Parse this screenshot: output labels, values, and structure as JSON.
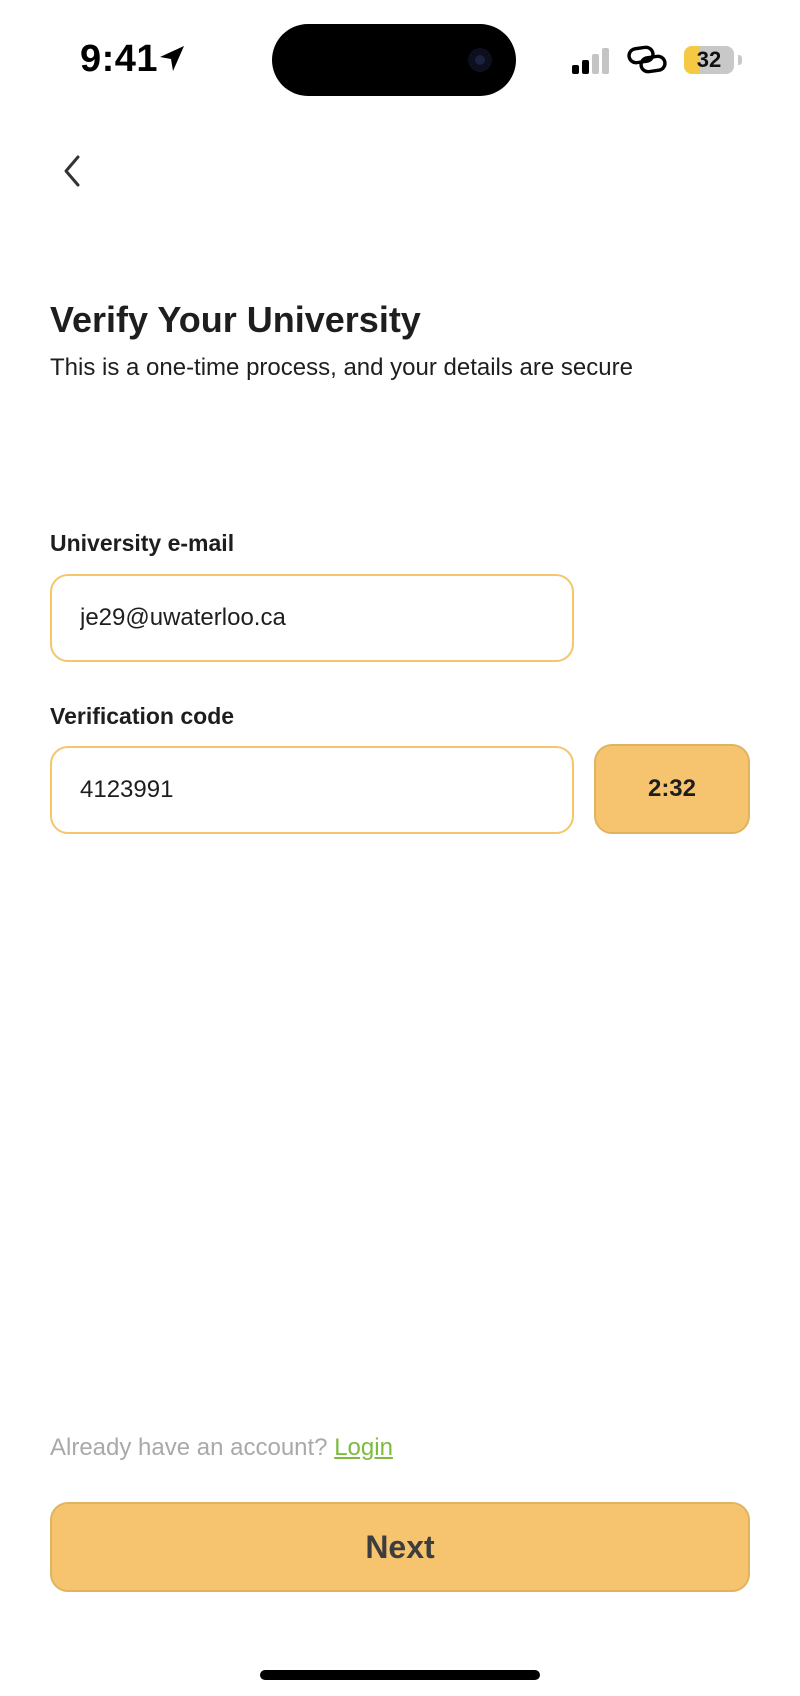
{
  "status_bar": {
    "time": "9:41",
    "battery_level": 32,
    "battery_label": "32",
    "battery_color": "#f6c945"
  },
  "header": {
    "back_icon": "chevron-left-icon",
    "title": "Verify Your University",
    "subtitle": "This is a one-time process, and your details are secure"
  },
  "form": {
    "email_label": "University e-mail",
    "email_value": "je29@uwaterloo.ca",
    "code_label": "Verification code",
    "code_value": "4123991",
    "timer_label": "2:32"
  },
  "footer": {
    "login_prompt": "Already have an account?",
    "login_link": "Login",
    "next_label": "Next"
  },
  "colors": {
    "accent": "#f6c46f",
    "field_border": "#f5c56c",
    "link": "#7dbb3f",
    "muted_text": "#a9a9a9"
  }
}
